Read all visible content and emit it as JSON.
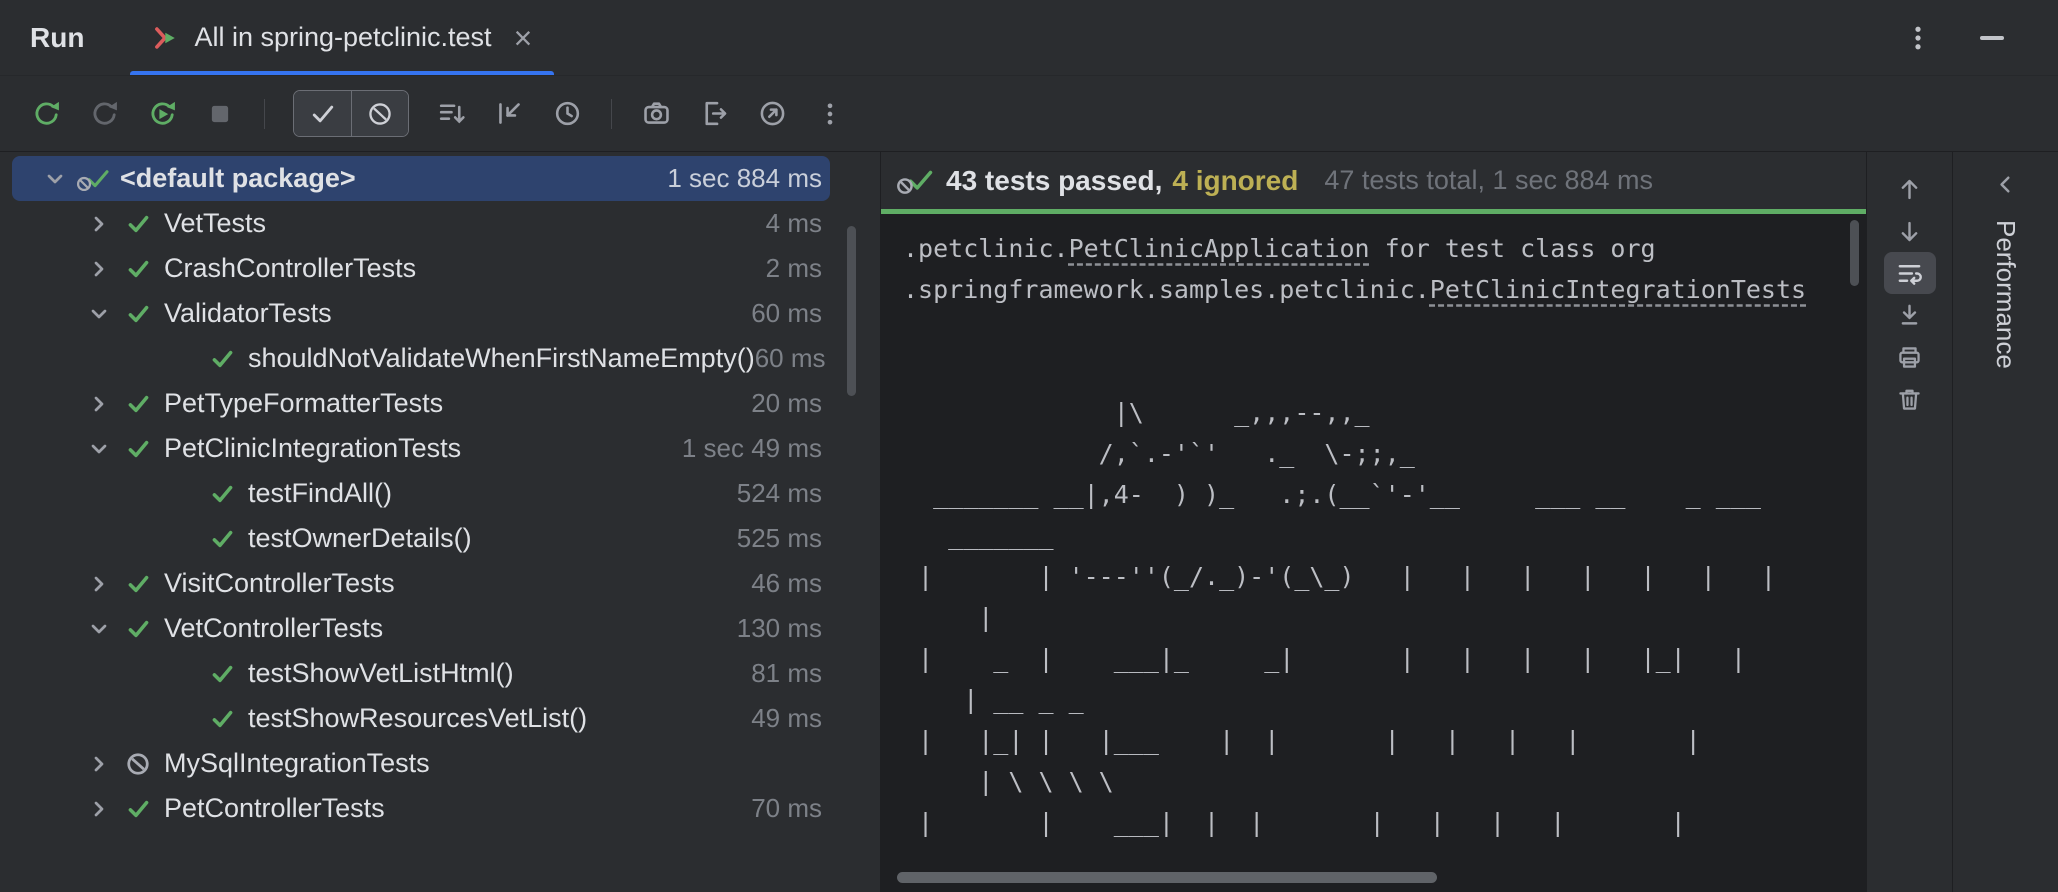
{
  "header": {
    "title": "Run",
    "tab_label": "All in spring-petclinic.test",
    "close_label": "×"
  },
  "summary": {
    "passed_text": "43 tests passed,",
    "ignored_text": "4 ignored",
    "total_text": "47 tests total, 1 sec 884 ms"
  },
  "tree": {
    "rows": [
      {
        "level": 0,
        "chevron": "down",
        "icon": "passed_ignored",
        "label": "<default package>",
        "duration": "1 sec 884 ms",
        "selected": true,
        "bold": true
      },
      {
        "level": 1,
        "chevron": "right",
        "icon": "passed",
        "label": "VetTests",
        "duration": "4 ms"
      },
      {
        "level": 1,
        "chevron": "right",
        "icon": "passed",
        "label": "CrashControllerTests",
        "duration": "2 ms"
      },
      {
        "level": 1,
        "chevron": "down",
        "icon": "passed",
        "label": "ValidatorTests",
        "duration": "60 ms"
      },
      {
        "level": 2,
        "chevron": "none",
        "icon": "passed",
        "label": "shouldNotValidateWhenFirstNameEmpty()",
        "duration": "60 ms"
      },
      {
        "level": 1,
        "chevron": "right",
        "icon": "passed",
        "label": "PetTypeFormatterTests",
        "duration": "20 ms"
      },
      {
        "level": 1,
        "chevron": "down",
        "icon": "passed",
        "label": "PetClinicIntegrationTests",
        "duration": "1 sec 49 ms"
      },
      {
        "level": 2,
        "chevron": "none",
        "icon": "passed",
        "label": "testFindAll()",
        "duration": "524 ms"
      },
      {
        "level": 2,
        "chevron": "none",
        "icon": "passed",
        "label": "testOwnerDetails()",
        "duration": "525 ms"
      },
      {
        "level": 1,
        "chevron": "right",
        "icon": "passed",
        "label": "VisitControllerTests",
        "duration": "46 ms"
      },
      {
        "level": 1,
        "chevron": "down",
        "icon": "passed",
        "label": "VetControllerTests",
        "duration": "130 ms"
      },
      {
        "level": 2,
        "chevron": "none",
        "icon": "passed",
        "label": "testShowVetListHtml()",
        "duration": "81 ms"
      },
      {
        "level": 2,
        "chevron": "none",
        "icon": "passed",
        "label": "testShowResourcesVetList()",
        "duration": "49 ms"
      },
      {
        "level": 1,
        "chevron": "right",
        "icon": "ignored",
        "label": "MySqlIntegrationTests",
        "duration": ""
      },
      {
        "level": 1,
        "chevron": "right",
        "icon": "passed",
        "label": "PetControllerTests",
        "duration": "70 ms"
      }
    ]
  },
  "console": {
    "lines": [
      ".petclinic.PetClinicApplication for test class org",
      ".springframework.samples.petclinic.PetClinicIntegrationTests",
      "",
      "",
      "              |\\      _,,,--,,_",
      "             /,`.-'`'   ._  \\-;;,_",
      "  _______ __|,4-  ) )_   .;.(__`'-'__     ___ __    _ ___",
      "   _______",
      " |       | '---''(_/._)-'(_\\_)   |   |   |   |   |   |   |",
      "     |",
      " |    _  |    ___|_     _|       |   |   |   |   |_|   |",
      "    | __ _ _",
      " |   |_| |   |___    |  |       |   |   |   |       |",
      "     | \\ \\ \\ \\",
      " |       |    ___|  |  |       |   |   |   |       |"
    ],
    "links": [
      "PetClinicApplication",
      "PetClinicIntegrationTests"
    ]
  },
  "stripe": {
    "label": "Performance"
  },
  "colors": {
    "accent": "#3574f0",
    "passed_green": "#5fad65",
    "ignored_yellow": "#bdb054",
    "selection_blue": "#2e436e"
  }
}
